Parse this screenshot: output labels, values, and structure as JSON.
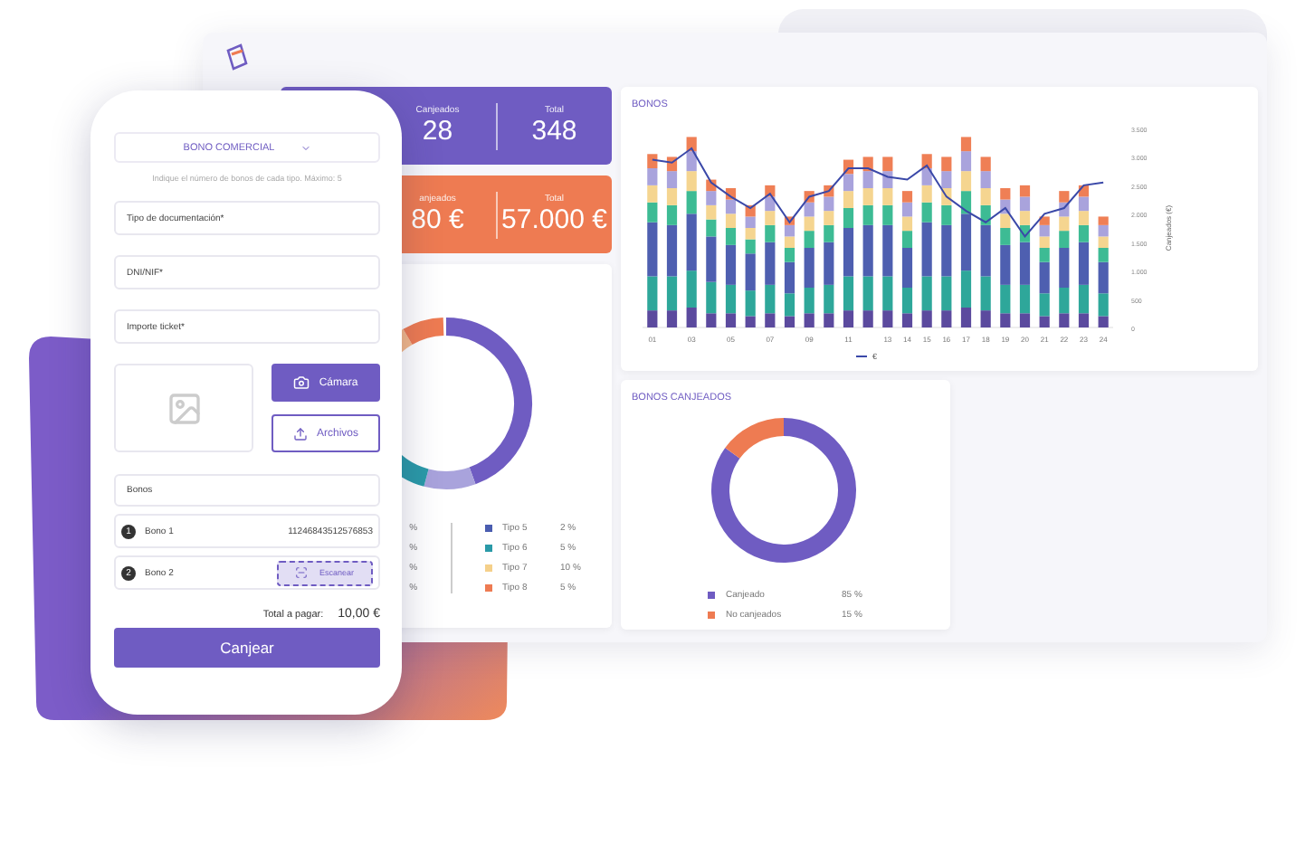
{
  "dashboard": {
    "stat_cards": [
      {
        "color": "#6f5cc2",
        "label": "Canjeados",
        "value": "28",
        "total_label": "Total",
        "total": "348"
      },
      {
        "color": "#ee7b52",
        "label": "anjeados",
        "value": "80 €",
        "total_label": "Total",
        "total": "57.000 €"
      }
    ],
    "types_donut": {
      "legend_left": [
        "%",
        "%",
        "%",
        "%"
      ],
      "legend_right": [
        {
          "label": "Tipo 5",
          "value": "2 %",
          "color": "#4a5db0"
        },
        {
          "label": "Tipo 6",
          "value": "5 %",
          "color": "#2a9aa8"
        },
        {
          "label": "Tipo 7",
          "value": "10 %",
          "color": "#f5d08a"
        },
        {
          "label": "Tipo 8",
          "value": "5 %",
          "color": "#ee7b52"
        }
      ]
    },
    "bonos_chart": {
      "chart_data": {
        "type": "bar",
        "title": "BONOS",
        "stacked": true,
        "ylabel": "Canjeados (€)",
        "x": [
          1,
          2,
          3,
          4,
          5,
          6,
          7,
          8,
          9,
          10,
          11,
          12,
          13,
          14,
          15,
          16,
          17,
          18,
          19,
          20,
          21,
          22,
          23,
          24
        ],
        "xticks": [
          {
            "value": 1,
            "label": "01"
          },
          {
            "value": 3,
            "label": "03"
          },
          {
            "value": 5,
            "label": "05"
          },
          {
            "value": 7,
            "label": "07"
          },
          {
            "value": 9,
            "label": "09"
          },
          {
            "value": 11,
            "label": "11"
          },
          {
            "value": 13,
            "label": "13"
          },
          {
            "value": 14,
            "label": "14"
          },
          {
            "value": 15,
            "label": "15"
          },
          {
            "value": 16,
            "label": "16"
          },
          {
            "value": 17,
            "label": "17"
          },
          {
            "value": 18,
            "label": "18"
          },
          {
            "value": 19,
            "label": "19"
          },
          {
            "value": 20,
            "label": "20"
          },
          {
            "value": 21,
            "label": "21"
          },
          {
            "value": 22,
            "label": "22"
          },
          {
            "value": 23,
            "label": "23"
          },
          {
            "value": 24,
            "label": "24"
          }
        ],
        "xlim": [
          0.5,
          24.5
        ],
        "ylim": [
          0,
          3500
        ],
        "yticks": [
          {
            "value": 0,
            "label": "0"
          },
          {
            "value": 500,
            "label": "500"
          },
          {
            "value": 1000,
            "label": "1.000"
          },
          {
            "value": 1500,
            "label": "1.500"
          },
          {
            "value": 2000,
            "label": "2.000"
          },
          {
            "value": 2500,
            "label": "2.500"
          },
          {
            "value": 3000,
            "label": "3.000"
          },
          {
            "value": 3500,
            "label": "3.500"
          }
        ],
        "series": [
          {
            "color": "#5b4a9e",
            "values": [
              300,
              300,
              350,
              250,
              250,
              200,
              250,
              200,
              250,
              250,
              300,
              300,
              300,
              250,
              300,
              300,
              350,
              300,
              250,
              250,
              200,
              250,
              250,
              200
            ]
          },
          {
            "color": "#2ea79a",
            "values": [
              600,
              600,
              650,
              550,
              500,
              450,
              500,
              400,
              450,
              500,
              600,
              600,
              600,
              450,
              600,
              600,
              650,
              600,
              500,
              500,
              400,
              450,
              500,
              400
            ]
          },
          {
            "color": "#4e5fb0",
            "values": [
              950,
              900,
              1000,
              800,
              700,
              650,
              750,
              550,
              700,
              750,
              850,
              900,
              900,
              700,
              950,
              900,
              1000,
              900,
              700,
              750,
              550,
              700,
              750,
              550
            ]
          },
          {
            "color": "#3dbb94",
            "values": [
              350,
              350,
              400,
              300,
              300,
              250,
              300,
              250,
              300,
              300,
              350,
              350,
              350,
              300,
              350,
              350,
              400,
              350,
              300,
              300,
              250,
              300,
              300,
              250
            ]
          },
          {
            "color": "#f5d590",
            "values": [
              300,
              300,
              350,
              250,
              250,
              200,
              250,
              200,
              250,
              250,
              300,
              300,
              300,
              250,
              300,
              300,
              350,
              300,
              250,
              250,
              200,
              250,
              250,
              200
            ]
          },
          {
            "color": "#a9a3dc",
            "values": [
              300,
              300,
              350,
              250,
              250,
              200,
              250,
              200,
              250,
              250,
              300,
              300,
              300,
              250,
              300,
              300,
              350,
              300,
              250,
              250,
              200,
              250,
              250,
              200
            ]
          },
          {
            "color": "#ef7f55",
            "values": [
              250,
              250,
              250,
              200,
              200,
              200,
              200,
              150,
              200,
              200,
              250,
              250,
              250,
              200,
              250,
              250,
              250,
              250,
              200,
              200,
              150,
              200,
              200,
              150
            ]
          },
          {
            "name": "€",
            "type": "line",
            "color": "#3a48a8",
            "values": [
              2950,
              2900,
              3150,
              2550,
              2300,
              2100,
              2350,
              1850,
              2300,
              2400,
              2800,
              2800,
              2650,
              2600,
              2850,
              2300,
              2050,
              1850,
              2100,
              1600,
              2000,
              2100,
              2500,
              2550
            ]
          }
        ]
      }
    },
    "canjeados_chart": {
      "chart_data": {
        "type": "donut",
        "title": "BONOS CANJEADOS",
        "categories": [
          "Canjeado",
          "No canjeados"
        ],
        "series": [
          {
            "values": [
              85,
              15
            ]
          }
        ],
        "colors": [
          "#6f5cc2",
          "#ee7b52"
        ],
        "value_labels": [
          "85 %",
          "15 %"
        ]
      }
    }
  },
  "phone": {
    "product_select": {
      "value": "BONO COMERCIAL"
    },
    "hint": "Indique el número de bonos de cada tipo. Máximo: 5",
    "fields": [
      {
        "placeholder": "Tipo de documentación*"
      },
      {
        "placeholder": "DNI/NIF*"
      },
      {
        "placeholder": "Importe ticket*"
      }
    ],
    "photo_buttons": [
      {
        "kind": "camera",
        "label": "Cámara"
      },
      {
        "kind": "upload",
        "label": "Archivos"
      }
    ],
    "bonos_field": {
      "placeholder": "Bonos"
    },
    "bonos": [
      {
        "kind": "code",
        "number": "1",
        "label": "Bono 1",
        "code": "11246843512576853"
      },
      {
        "kind": "scan",
        "number": "2",
        "label": "Bono 2",
        "action": "Escanear"
      }
    ],
    "total_label": "Total a pagar:",
    "total": "10,00 €",
    "submit": "Canjear"
  }
}
